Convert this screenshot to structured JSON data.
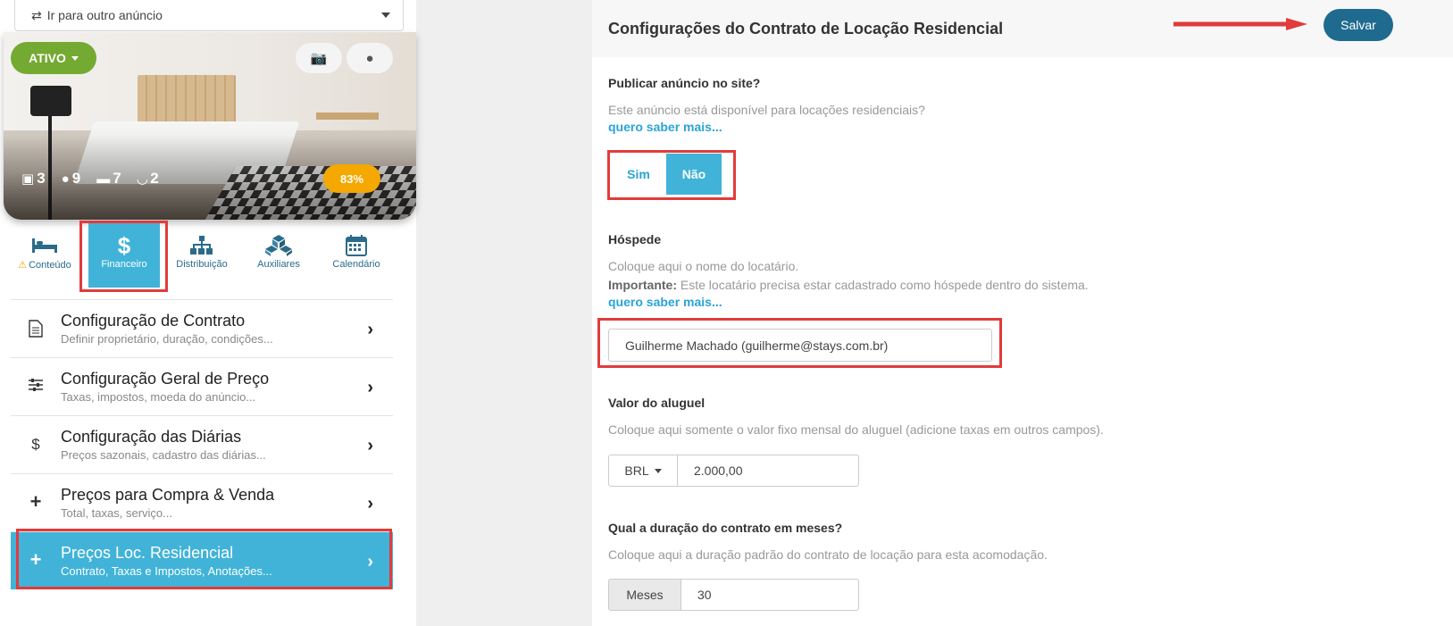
{
  "left": {
    "listing_select": {
      "label": "Ir para outro anúncio"
    },
    "status": {
      "label": "ATIVO"
    },
    "stats": [
      {
        "icon": "cube-icon",
        "value": "3"
      },
      {
        "icon": "user-icon",
        "value": "9"
      },
      {
        "icon": "bed-icon",
        "value": "7"
      },
      {
        "icon": "bathtub-icon",
        "value": "2"
      }
    ],
    "completion": "83%",
    "tabs": [
      {
        "label": "Conteúdo",
        "icon": "bed-icon"
      },
      {
        "label": "Financeiro",
        "icon": "dollar-icon"
      },
      {
        "label": "Distribuição",
        "icon": "sitemap-icon"
      },
      {
        "label": "Auxiliares",
        "icon": "cubes-icon"
      },
      {
        "label": "Calendário",
        "icon": "calendar-icon"
      }
    ],
    "menu": [
      {
        "title": "Configuração de Contrato",
        "subtitle": "Definir proprietário, duração, condições..."
      },
      {
        "title": "Configuração Geral de Preço",
        "subtitle": "Taxas, impostos, moeda do anúncio..."
      },
      {
        "title": "Configuração das Diárias",
        "subtitle": "Preços sazonais, cadastro das diárias..."
      },
      {
        "title": "Preços para Compra & Venda",
        "subtitle": "Total, taxas, serviço..."
      },
      {
        "title": "Preços Loc. Residencial",
        "subtitle": "Contrato, Taxas e Impostos, Anotações..."
      }
    ]
  },
  "right": {
    "title": "Configurações do Contrato de Locação Residencial",
    "save_label": "Salvar",
    "publish": {
      "label": "Publicar anúncio no site?",
      "help": "Este anúncio está disponível para locações residenciais?",
      "link": "quero saber mais...",
      "yes": "Sim",
      "no": "Não",
      "selected": "Não"
    },
    "guest": {
      "label": "Hóspede",
      "help": "Coloque aqui o nome do locatário.",
      "important_label": "Importante:",
      "important_text": " Este locatário precisa estar cadastrado como hóspede dentro do sistema.",
      "link": "quero saber mais...",
      "value": "Guilherme Machado (guilherme@stays.com.br)"
    },
    "rent": {
      "label": "Valor do aluguel",
      "help": "Coloque aqui somente o valor fixo mensal do aluguel (adicione taxas em outros campos).",
      "currency": "BRL",
      "value": "2.000,00"
    },
    "duration": {
      "label": "Qual a duração do contrato em meses?",
      "help": "Coloque aqui a duração padrão do contrato de locação para esta acomodação.",
      "unit": "Meses",
      "value": "30"
    }
  }
}
